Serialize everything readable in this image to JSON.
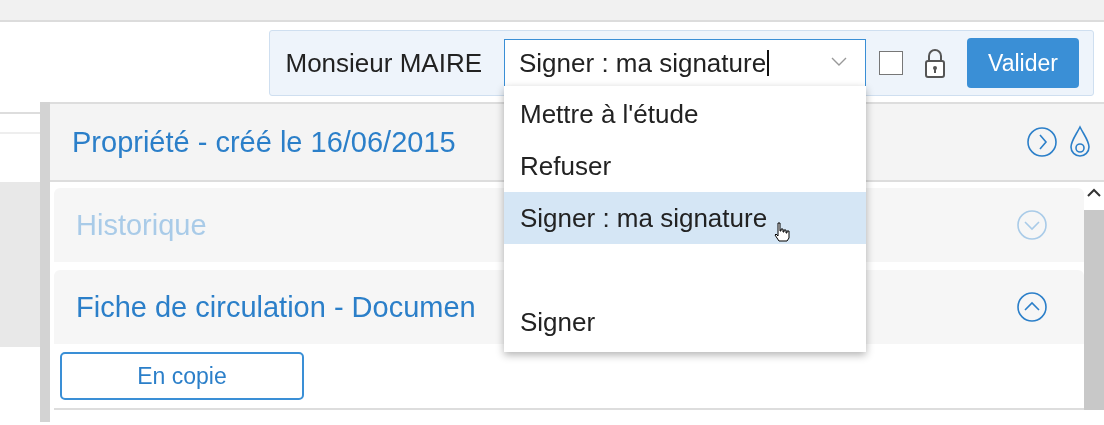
{
  "toolbar": {
    "user": "Monsieur MAIRE",
    "action_select": {
      "value": "Signer : ma signature",
      "expanded": true
    },
    "checkbox": {
      "checked": false
    },
    "locked": true,
    "submit": "Valider"
  },
  "action_menu": [
    {
      "kind": "option",
      "label": "Mettre à l'étude",
      "selected": false
    },
    {
      "kind": "option",
      "label": "Refuser",
      "selected": false
    },
    {
      "kind": "option",
      "label": "Signer : ma signature",
      "selected": true
    },
    {
      "kind": "blank",
      "selected": false
    },
    {
      "kind": "option",
      "label": "Signer",
      "selected": false
    }
  ],
  "panel": {
    "title": "Propriété - créé le 16/06/2015",
    "sections": [
      {
        "title": "Historique",
        "expanded": false,
        "disabled": true
      },
      {
        "title": "Fiche de circulation - Documen",
        "expanded": true,
        "disabled": false,
        "buttons": [
          "En copie"
        ]
      }
    ]
  }
}
